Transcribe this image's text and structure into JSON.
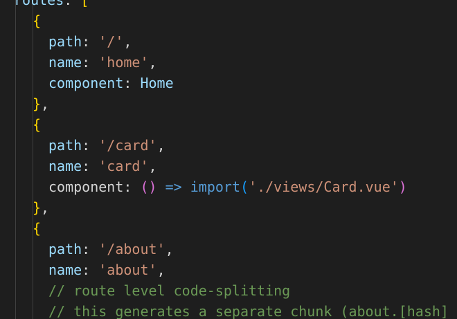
{
  "editor": {
    "lines": [
      {
        "indent": 0,
        "tokens": [
          {
            "t": "routes",
            "k": "prop"
          },
          {
            "t": ": ",
            "k": "punct"
          },
          {
            "t": "[",
            "k": "brace"
          }
        ]
      },
      {
        "indent": 2,
        "tokens": [
          {
            "t": "{",
            "k": "brace"
          }
        ]
      },
      {
        "indent": 3,
        "tokens": [
          {
            "t": "path",
            "k": "prop"
          },
          {
            "t": ": ",
            "k": "punct"
          },
          {
            "t": "'/'",
            "k": "str"
          },
          {
            "t": ",",
            "k": "punct"
          }
        ]
      },
      {
        "indent": 3,
        "tokens": [
          {
            "t": "name",
            "k": "prop"
          },
          {
            "t": ": ",
            "k": "punct"
          },
          {
            "t": "'home'",
            "k": "str"
          },
          {
            "t": ",",
            "k": "punct"
          }
        ]
      },
      {
        "indent": 3,
        "tokens": [
          {
            "t": "component",
            "k": "prop"
          },
          {
            "t": ": ",
            "k": "punct"
          },
          {
            "t": "Home",
            "k": "ident"
          }
        ]
      },
      {
        "indent": 2,
        "tokens": [
          {
            "t": "}",
            "k": "brace"
          },
          {
            "t": ",",
            "k": "punct"
          }
        ]
      },
      {
        "indent": 2,
        "tokens": [
          {
            "t": "{",
            "k": "brace"
          }
        ]
      },
      {
        "indent": 3,
        "tokens": [
          {
            "t": "path",
            "k": "prop"
          },
          {
            "t": ": ",
            "k": "punct"
          },
          {
            "t": "'/card'",
            "k": "str"
          },
          {
            "t": ",",
            "k": "punct"
          }
        ]
      },
      {
        "indent": 3,
        "tokens": [
          {
            "t": "name",
            "k": "prop"
          },
          {
            "t": ": ",
            "k": "punct"
          },
          {
            "t": "'card'",
            "k": "str"
          },
          {
            "t": ",",
            "k": "punct"
          }
        ]
      },
      {
        "indent": 3,
        "tokens": [
          {
            "t": "component",
            "k": "default"
          },
          {
            "t": ": ",
            "k": "punct"
          },
          {
            "t": "()",
            "k": "paren"
          },
          {
            "t": " ",
            "k": "punct"
          },
          {
            "t": "=>",
            "k": "arrow"
          },
          {
            "t": " ",
            "k": "punct"
          },
          {
            "t": "import",
            "k": "func"
          },
          {
            "t": "(",
            "k": "importparen"
          },
          {
            "t": "'./views/Card.vue'",
            "k": "str"
          },
          {
            "t": ")",
            "k": "paren"
          }
        ]
      },
      {
        "indent": 2,
        "tokens": [
          {
            "t": "}",
            "k": "brace"
          },
          {
            "t": ",",
            "k": "punct"
          }
        ]
      },
      {
        "indent": 2,
        "tokens": [
          {
            "t": "{",
            "k": "brace"
          }
        ]
      },
      {
        "indent": 3,
        "tokens": [
          {
            "t": "path",
            "k": "prop"
          },
          {
            "t": ": ",
            "k": "punct"
          },
          {
            "t": "'/about'",
            "k": "str"
          },
          {
            "t": ",",
            "k": "punct"
          }
        ]
      },
      {
        "indent": 3,
        "tokens": [
          {
            "t": "name",
            "k": "prop"
          },
          {
            "t": ": ",
            "k": "punct"
          },
          {
            "t": "'about'",
            "k": "str"
          },
          {
            "t": ",",
            "k": "punct"
          }
        ]
      },
      {
        "indent": 3,
        "tokens": [
          {
            "t": "// route level code-splitting",
            "k": "comment"
          }
        ]
      },
      {
        "indent": 3,
        "tokens": [
          {
            "t": "// this generates a separate chunk (about.[hash]",
            "k": "comment"
          }
        ]
      }
    ],
    "colors": {
      "background": "#1e1e1e",
      "property": "#9cdcfe",
      "string": "#ce9178",
      "brace": "#ffd700",
      "paren": "#da70d6",
      "keyword": "#569cd6",
      "comment": "#6a9955"
    }
  }
}
